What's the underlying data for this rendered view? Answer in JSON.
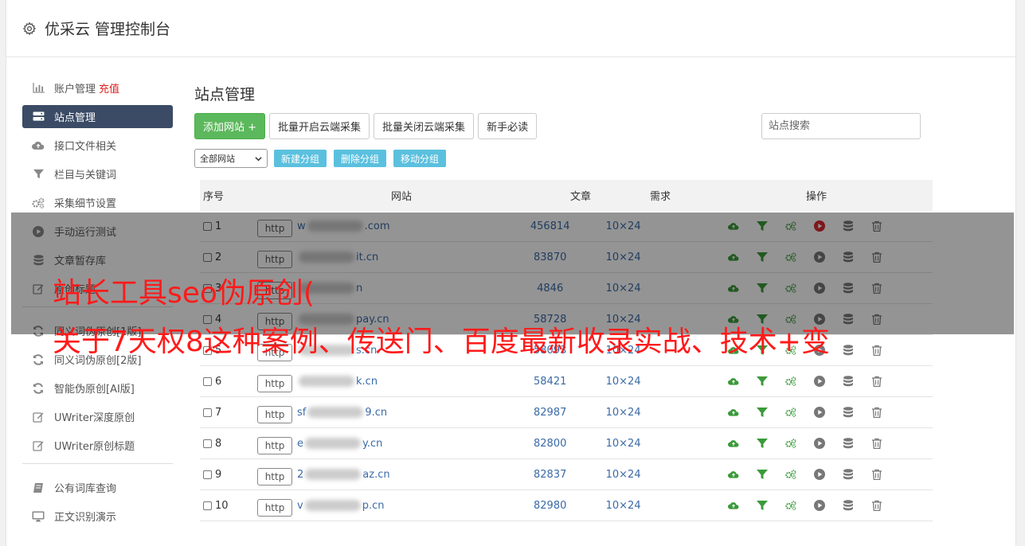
{
  "header": {
    "title": "优采云 管理控制台"
  },
  "sidebar": {
    "items": [
      {
        "label": "账户管理",
        "extra": "充值",
        "icon": "bar-chart-icon"
      },
      {
        "label": "站点管理",
        "icon": "server-icon",
        "active": true
      },
      {
        "label": "接口文件相关",
        "icon": "cloud-upload-icon"
      },
      {
        "label": "栏目与关键词",
        "icon": "filter-icon"
      },
      {
        "label": "采集细节设置",
        "icon": "cogs-icon"
      },
      {
        "label": "手动运行测试",
        "icon": "play-icon"
      },
      {
        "label": "文章暂存库",
        "icon": "database-icon"
      },
      {
        "label": "原创标题",
        "icon": "edit-icon"
      },
      {
        "label": "同义词伪原创[1版]",
        "icon": "refresh-icon"
      },
      {
        "label": "同义词伪原创[2版]",
        "icon": "refresh-icon"
      },
      {
        "label": "智能伪原创[AI版]",
        "icon": "refresh-icon"
      },
      {
        "label": "UWriter深度原创",
        "icon": "edit-icon"
      },
      {
        "label": "UWriter原创标题",
        "icon": "edit-icon"
      },
      {
        "label": "公有词库查询",
        "icon": "book-icon"
      },
      {
        "label": "正文识别演示",
        "icon": "desktop-icon"
      }
    ]
  },
  "main": {
    "title": "站点管理",
    "buttons": {
      "add": "添加网站 +",
      "batch_open": "批量开启云端采集",
      "batch_close": "批量关闭云端采集",
      "guide": "新手必读"
    },
    "search_placeholder": "站点搜索",
    "group_select": "全部网站",
    "group_buttons": {
      "new": "新建分组",
      "delete": "删除分组",
      "move": "移动分组"
    },
    "table": {
      "headers": {
        "no": "序号",
        "site": "网站",
        "articles": "文章",
        "need": "需求",
        "ops": "操作"
      },
      "rows": [
        {
          "no": "1",
          "proto": "http",
          "domain_start": "w",
          "domain_end": ".com",
          "articles": "456814",
          "need": "10×24"
        },
        {
          "no": "2",
          "proto": "http",
          "domain_start": "",
          "domain_end": "it.cn",
          "articles": "83870",
          "need": "10×24"
        },
        {
          "no": "3",
          "proto": "http",
          "domain_start": "",
          "domain_end": "n",
          "articles": "4846",
          "need": "10×24"
        },
        {
          "no": "4",
          "proto": "http",
          "domain_start": "",
          "domain_end": "pay.cn",
          "articles": "58728",
          "need": "10×24"
        },
        {
          "no": "5",
          "proto": "http",
          "domain_start": "",
          "domain_end": "s.cn",
          "articles": "58093",
          "need": "10×24"
        },
        {
          "no": "6",
          "proto": "http",
          "domain_start": "",
          "domain_end": "k.cn",
          "articles": "58421",
          "need": "10×24"
        },
        {
          "no": "7",
          "proto": "http",
          "domain_start": "sf",
          "domain_end": "9.cn",
          "articles": "82987",
          "need": "10×24"
        },
        {
          "no": "8",
          "proto": "http",
          "domain_start": "e",
          "domain_end": "y.cn",
          "articles": "82800",
          "need": "10×24"
        },
        {
          "no": "9",
          "proto": "http",
          "domain_start": "2",
          "domain_end": "az.cn",
          "articles": "82837",
          "need": "10×24"
        },
        {
          "no": "10",
          "proto": "http",
          "domain_start": "v",
          "domain_end": "p.cn",
          "articles": "82980",
          "need": "10×24"
        }
      ]
    }
  },
  "overlay": {
    "line1": "站长工具seo伪原创(",
    "line2": "关于7天权8这种案例、传送门、百度最新收录实战、技术+变"
  },
  "colors": {
    "accent_active": "#3b4b66",
    "green_button": "#5cb85c",
    "info_button": "#5bc0de",
    "link": "#3a6aa6",
    "overlay_text": "#ff1a1a",
    "charge": "#e02020"
  }
}
